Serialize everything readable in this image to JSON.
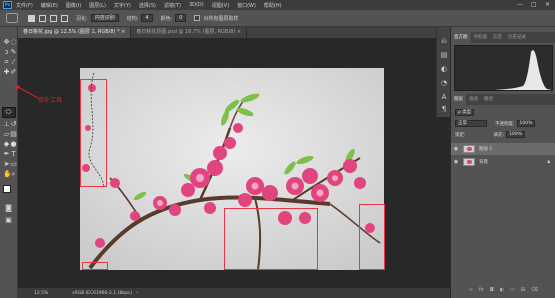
{
  "menubar": {
    "app_icon": "Ps",
    "items": [
      "文件(F)",
      "编辑(E)",
      "图像(I)",
      "图层(L)",
      "文字(Y)",
      "选择(S)",
      "滤镜(T)",
      "3D(D)",
      "视图(V)",
      "窗口(W)",
      "帮助(H)"
    ],
    "window_controls": [
      "—",
      "□",
      "✕"
    ]
  },
  "options": {
    "feather_label": "羽化:",
    "feather_value": "0 像素",
    "antialias_label": "内容识别",
    "tolerance_label": "结构:",
    "tolerance_value": "4",
    "color_label": "颜色:",
    "color_value": "0",
    "sample_all_label": "对所有图层取样"
  },
  "tabs": [
    {
      "label": "春日桃花.jpg @ 12.5% (图层 1, RGB/8) *  ×",
      "active": true
    },
    {
      "label": "春日桃花原图.psd @ 16.7% (图层, RGB/8)  ×",
      "active": false
    }
  ],
  "annotation": {
    "text": "修补工具"
  },
  "status": {
    "zoom": "12.5%",
    "info": "sRGB IEC61966-2.1 (8bpc)"
  },
  "histogram_panel": {
    "tabs": [
      "直方图",
      "导航器",
      "信息",
      "历史记录"
    ]
  },
  "layers_panel": {
    "tabs": [
      "图层",
      "通道",
      "路径"
    ],
    "kind_label": "ρ 类型",
    "blend_mode": "正常",
    "opacity_label": "不透明度:",
    "opacity_value": "100%",
    "lock_label": "锁定:",
    "fill_label": "填充:",
    "fill_value": "100%",
    "layers": [
      {
        "name": "图层 1",
        "selected": true
      },
      {
        "name": "背景",
        "selected": false,
        "locked": true
      }
    ]
  },
  "colors": {
    "accent_red": "#e83848",
    "annotation_red": "#d8232a",
    "blossom": "#e0457f",
    "leaf": "#7fc04a"
  }
}
